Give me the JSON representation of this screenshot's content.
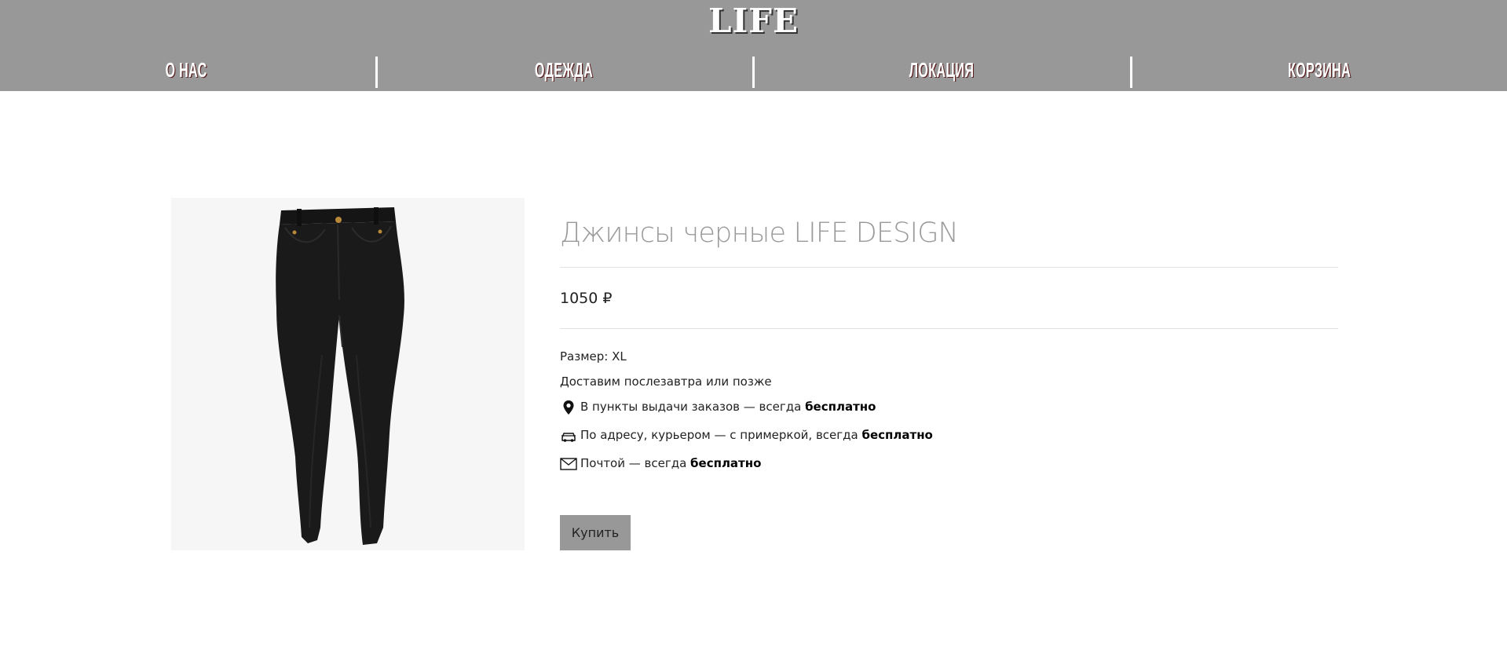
{
  "header": {
    "logo": "LIFE",
    "nav": [
      {
        "label": "О НАС"
      },
      {
        "label": "ОДЕЖДА"
      },
      {
        "label": "ЛОКАЦИЯ"
      },
      {
        "label": "КОРЗИНА"
      }
    ]
  },
  "product": {
    "title": "Джинсы черные LIFE DESIGN",
    "price": "1050 ₽",
    "size_text": "Размер: XL",
    "delivery_note": "Доставим послезавтра или позже",
    "delivery_options": [
      {
        "icon": "map-pin-icon",
        "text": "В пункты выдачи заказов — всегда ",
        "bold": "бесплатно"
      },
      {
        "icon": "car-icon",
        "text": "По адресу, курьером — с примеркой, всегда ",
        "bold": "бесплатно"
      },
      {
        "icon": "envelope-icon",
        "text": "Почтой — всегда ",
        "bold": "бесплатно"
      }
    ],
    "buy_label": "Купить"
  },
  "colors": {
    "header_bg": "#989898",
    "title": "#9a9a9a",
    "button_bg": "#989898"
  }
}
